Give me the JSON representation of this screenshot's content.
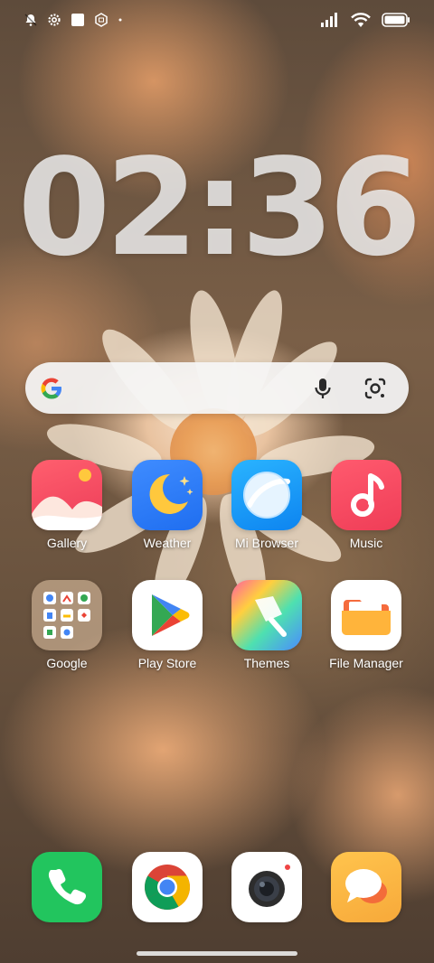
{
  "status_bar": {
    "left_icons": [
      "bell-off-icon",
      "settings-gear-icon",
      "square-notification-icon",
      "mi-hexagon-icon",
      "dot-icon"
    ],
    "right_icons": [
      "cellular-signal-icon",
      "wifi-icon",
      "battery-icon"
    ]
  },
  "clock": {
    "time": "02:36"
  },
  "search": {
    "icons": [
      "google-g-icon",
      "microphone-icon",
      "google-lens-icon"
    ]
  },
  "apps": [
    {
      "label": "Gallery",
      "icon": "gallery-icon"
    },
    {
      "label": "Weather",
      "icon": "weather-icon"
    },
    {
      "label": "Mi Browser",
      "icon": "browser-icon"
    },
    {
      "label": "Music",
      "icon": "music-icon"
    },
    {
      "label": "Google",
      "icon": "google-folder-icon"
    },
    {
      "label": "Play Store",
      "icon": "play-store-icon"
    },
    {
      "label": "Themes",
      "icon": "themes-icon"
    },
    {
      "label": "File Manager",
      "icon": "file-manager-icon"
    }
  ],
  "dock": [
    {
      "icon": "phone-icon"
    },
    {
      "icon": "chrome-icon"
    },
    {
      "icon": "camera-icon"
    },
    {
      "icon": "messages-icon"
    }
  ],
  "colors": {
    "gallery": "#ef4b5e",
    "weather": "#2f7cf6",
    "browser": "#1d96f0",
    "music": "#f2475d",
    "phone": "#22c55e",
    "messages": "#f8b43c"
  }
}
